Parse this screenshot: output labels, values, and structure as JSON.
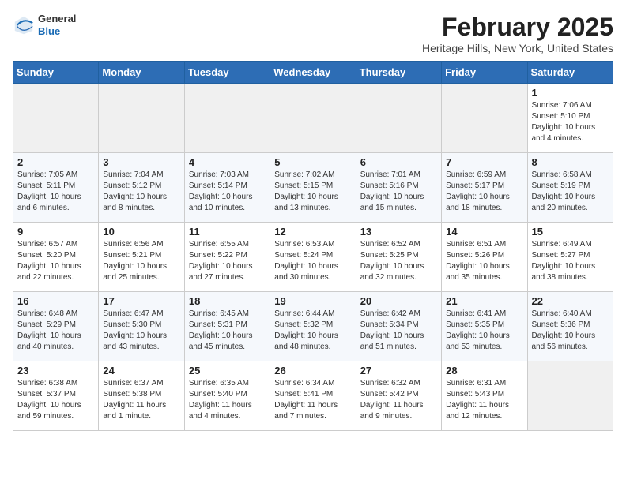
{
  "header": {
    "logo": {
      "general": "General",
      "blue": "Blue"
    },
    "title": "February 2025",
    "subtitle": "Heritage Hills, New York, United States"
  },
  "weekdays": [
    "Sunday",
    "Monday",
    "Tuesday",
    "Wednesday",
    "Thursday",
    "Friday",
    "Saturday"
  ],
  "weeks": [
    [
      {
        "day": "",
        "info": ""
      },
      {
        "day": "",
        "info": ""
      },
      {
        "day": "",
        "info": ""
      },
      {
        "day": "",
        "info": ""
      },
      {
        "day": "",
        "info": ""
      },
      {
        "day": "",
        "info": ""
      },
      {
        "day": "1",
        "info": "Sunrise: 7:06 AM\nSunset: 5:10 PM\nDaylight: 10 hours and 4 minutes."
      }
    ],
    [
      {
        "day": "2",
        "info": "Sunrise: 7:05 AM\nSunset: 5:11 PM\nDaylight: 10 hours and 6 minutes."
      },
      {
        "day": "3",
        "info": "Sunrise: 7:04 AM\nSunset: 5:12 PM\nDaylight: 10 hours and 8 minutes."
      },
      {
        "day": "4",
        "info": "Sunrise: 7:03 AM\nSunset: 5:14 PM\nDaylight: 10 hours and 10 minutes."
      },
      {
        "day": "5",
        "info": "Sunrise: 7:02 AM\nSunset: 5:15 PM\nDaylight: 10 hours and 13 minutes."
      },
      {
        "day": "6",
        "info": "Sunrise: 7:01 AM\nSunset: 5:16 PM\nDaylight: 10 hours and 15 minutes."
      },
      {
        "day": "7",
        "info": "Sunrise: 6:59 AM\nSunset: 5:17 PM\nDaylight: 10 hours and 18 minutes."
      },
      {
        "day": "8",
        "info": "Sunrise: 6:58 AM\nSunset: 5:19 PM\nDaylight: 10 hours and 20 minutes."
      }
    ],
    [
      {
        "day": "9",
        "info": "Sunrise: 6:57 AM\nSunset: 5:20 PM\nDaylight: 10 hours and 22 minutes."
      },
      {
        "day": "10",
        "info": "Sunrise: 6:56 AM\nSunset: 5:21 PM\nDaylight: 10 hours and 25 minutes."
      },
      {
        "day": "11",
        "info": "Sunrise: 6:55 AM\nSunset: 5:22 PM\nDaylight: 10 hours and 27 minutes."
      },
      {
        "day": "12",
        "info": "Sunrise: 6:53 AM\nSunset: 5:24 PM\nDaylight: 10 hours and 30 minutes."
      },
      {
        "day": "13",
        "info": "Sunrise: 6:52 AM\nSunset: 5:25 PM\nDaylight: 10 hours and 32 minutes."
      },
      {
        "day": "14",
        "info": "Sunrise: 6:51 AM\nSunset: 5:26 PM\nDaylight: 10 hours and 35 minutes."
      },
      {
        "day": "15",
        "info": "Sunrise: 6:49 AM\nSunset: 5:27 PM\nDaylight: 10 hours and 38 minutes."
      }
    ],
    [
      {
        "day": "16",
        "info": "Sunrise: 6:48 AM\nSunset: 5:29 PM\nDaylight: 10 hours and 40 minutes."
      },
      {
        "day": "17",
        "info": "Sunrise: 6:47 AM\nSunset: 5:30 PM\nDaylight: 10 hours and 43 minutes."
      },
      {
        "day": "18",
        "info": "Sunrise: 6:45 AM\nSunset: 5:31 PM\nDaylight: 10 hours and 45 minutes."
      },
      {
        "day": "19",
        "info": "Sunrise: 6:44 AM\nSunset: 5:32 PM\nDaylight: 10 hours and 48 minutes."
      },
      {
        "day": "20",
        "info": "Sunrise: 6:42 AM\nSunset: 5:34 PM\nDaylight: 10 hours and 51 minutes."
      },
      {
        "day": "21",
        "info": "Sunrise: 6:41 AM\nSunset: 5:35 PM\nDaylight: 10 hours and 53 minutes."
      },
      {
        "day": "22",
        "info": "Sunrise: 6:40 AM\nSunset: 5:36 PM\nDaylight: 10 hours and 56 minutes."
      }
    ],
    [
      {
        "day": "23",
        "info": "Sunrise: 6:38 AM\nSunset: 5:37 PM\nDaylight: 10 hours and 59 minutes."
      },
      {
        "day": "24",
        "info": "Sunrise: 6:37 AM\nSunset: 5:38 PM\nDaylight: 11 hours and 1 minute."
      },
      {
        "day": "25",
        "info": "Sunrise: 6:35 AM\nSunset: 5:40 PM\nDaylight: 11 hours and 4 minutes."
      },
      {
        "day": "26",
        "info": "Sunrise: 6:34 AM\nSunset: 5:41 PM\nDaylight: 11 hours and 7 minutes."
      },
      {
        "day": "27",
        "info": "Sunrise: 6:32 AM\nSunset: 5:42 PM\nDaylight: 11 hours and 9 minutes."
      },
      {
        "day": "28",
        "info": "Sunrise: 6:31 AM\nSunset: 5:43 PM\nDaylight: 11 hours and 12 minutes."
      },
      {
        "day": "",
        "info": ""
      }
    ]
  ]
}
